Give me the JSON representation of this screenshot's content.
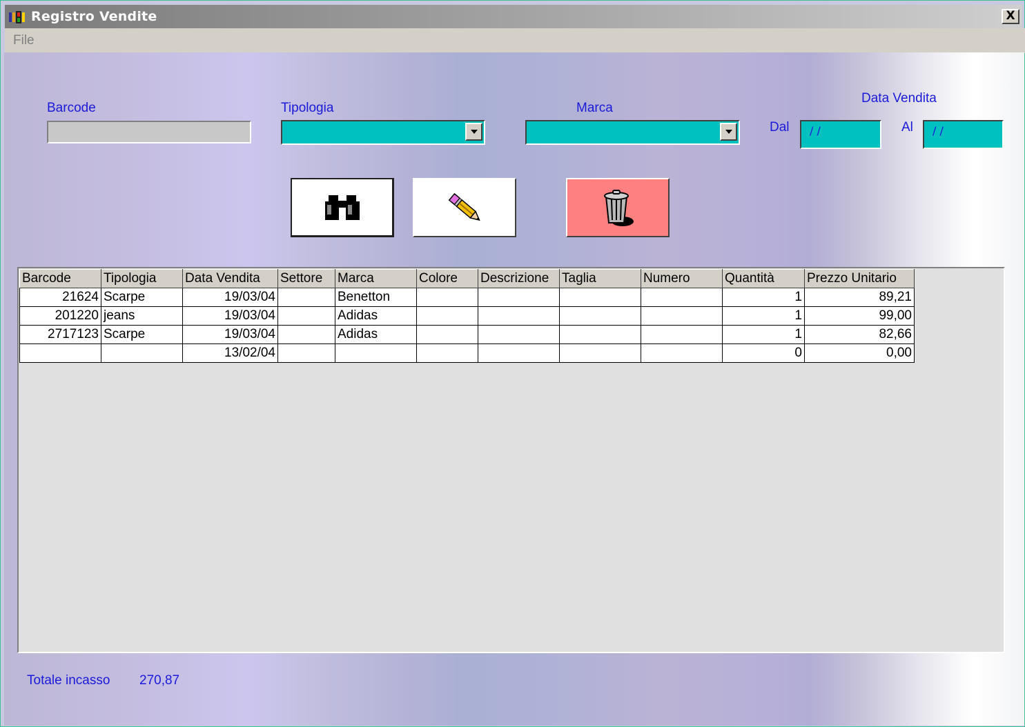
{
  "window": {
    "title": "Registro Vendite",
    "close_label": "X"
  },
  "menu": {
    "file": "File"
  },
  "filters": {
    "barcode_label": "Barcode",
    "tipologia_label": "Tipologia",
    "marca_label": "Marca",
    "data_vendita_label": "Data Vendita",
    "dal_label": "Dal",
    "al_label": "Al",
    "barcode_value": "",
    "tipologia_value": "",
    "marca_value": "",
    "dal_value": "/ /",
    "al_value": "/ /"
  },
  "toolbar": {
    "search_icon": "binoculars-icon",
    "edit_icon": "pencil-icon",
    "delete_icon": "trash-icon",
    "delete_color": "#ff8080"
  },
  "table": {
    "columns": [
      "Barcode",
      "Tipologia",
      "Data Vendita",
      "Settore",
      "Marca",
      "Colore",
      "Descrizione",
      "Taglia",
      "Numero",
      "Quantità",
      "Prezzo Unitario"
    ],
    "rows": [
      [
        "21624",
        "Scarpe",
        "19/03/04",
        "",
        "Benetton",
        "",
        "",
        "",
        "",
        "1",
        "89,21"
      ],
      [
        "201220",
        "jeans",
        "19/03/04",
        "",
        "Adidas",
        "",
        "",
        "",
        "",
        "1",
        "99,00"
      ],
      [
        "2717123",
        "Scarpe",
        "19/03/04",
        "",
        "Adidas",
        "",
        "",
        "",
        "",
        "1",
        "82,66"
      ],
      [
        "",
        "",
        "13/02/04",
        "",
        "",
        "",
        "",
        "",
        "",
        "0",
        "0,00"
      ]
    ]
  },
  "footer": {
    "total_label": "Totale incasso",
    "total_value": "270,87"
  }
}
